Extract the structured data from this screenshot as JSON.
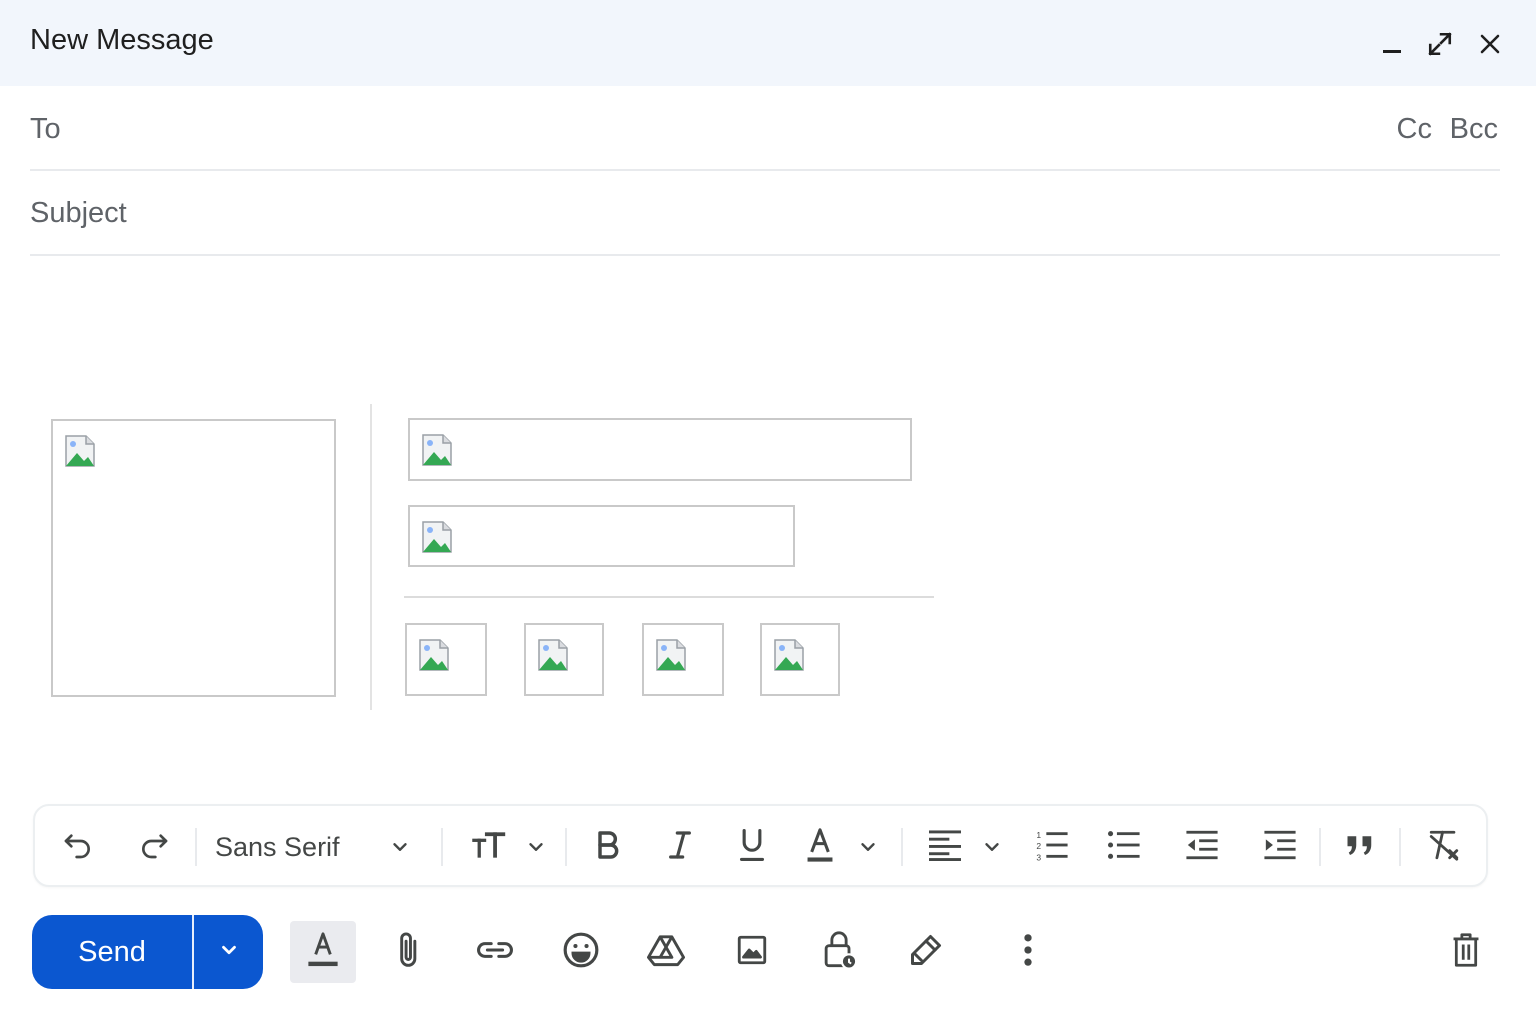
{
  "header": {
    "title": "New Message"
  },
  "fields": {
    "to_label": "To",
    "to_value": "",
    "cc_label": "Cc",
    "bcc_label": "Bcc",
    "subject_placeholder": "Subject",
    "subject_value": ""
  },
  "formatting": {
    "font_family": "Sans Serif"
  },
  "actions": {
    "send_label": "Send"
  },
  "colors": {
    "header_bg": "#f2f6fc",
    "send_button": "#0b57d0",
    "icon": "#444746",
    "label": "#5f6368"
  },
  "icons": {
    "header": [
      "minimize-icon",
      "fullscreen-icon",
      "close-icon"
    ],
    "formatting": [
      "undo-icon",
      "redo-icon",
      "font-size-icon",
      "bold-icon",
      "italic-icon",
      "underline-icon",
      "text-color-icon",
      "align-icon",
      "numbered-list-icon",
      "bulleted-list-icon",
      "indent-less-icon",
      "indent-more-icon",
      "quote-icon",
      "remove-formatting-icon"
    ],
    "actions": [
      "formatting-toggle-icon",
      "attach-icon",
      "link-icon",
      "emoji-icon",
      "drive-icon",
      "photo-icon",
      "confidential-mode-icon",
      "signature-icon",
      "more-options-icon",
      "discard-icon"
    ]
  }
}
